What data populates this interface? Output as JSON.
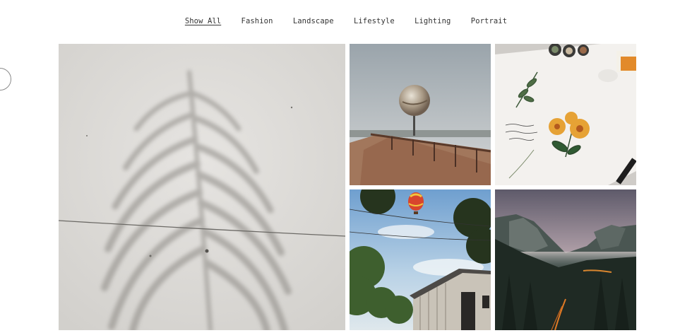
{
  "filters": [
    {
      "label": "Show All",
      "active": true
    },
    {
      "label": "Fashion",
      "active": false
    },
    {
      "label": "Landscape",
      "active": false
    },
    {
      "label": "Lifestyle",
      "active": false
    },
    {
      "label": "Lighting",
      "active": false
    },
    {
      "label": "Portrait",
      "active": false
    }
  ],
  "gallery": {
    "tiles": [
      {
        "subject": "palm-leaf-shadow",
        "category": ""
      },
      {
        "subject": "globe-sculpture-boardwalk",
        "category": ""
      },
      {
        "subject": "botanical-sketchbook",
        "category": ""
      },
      {
        "subject": "hot-air-balloon-barn",
        "category": ""
      },
      {
        "subject": "mountain-valley-dusk",
        "category": ""
      }
    ]
  }
}
